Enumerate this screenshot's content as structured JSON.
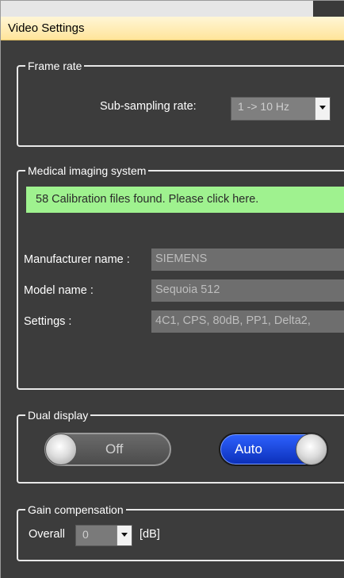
{
  "window": {
    "title": "Video Settings"
  },
  "frame_rate": {
    "legend": "Frame rate",
    "sub_sampling_label": "Sub-sampling rate:",
    "sub_sampling_value": "1 -> 10 Hz"
  },
  "medical": {
    "legend": "Medical imaging system",
    "calibration_message": "58 Calibration files found. Please click here.",
    "fields": [
      {
        "label": "Manufacturer name :",
        "value": "SIEMENS"
      },
      {
        "label": "Model name :",
        "value": "Sequoia 512"
      },
      {
        "label": "Settings :",
        "value": "4C1, CPS, 80dB, PP1, Delta2,"
      }
    ]
  },
  "dual_display": {
    "legend": "Dual display",
    "off_label": "Off",
    "auto_label": "Auto"
  },
  "gain": {
    "legend": "Gain compensation",
    "overall_label": "Overall",
    "overall_value": "0",
    "unit": "[dB]"
  },
  "colors": {
    "panel_bg": "#3c3c3c",
    "title_bg": "#ffe49a",
    "calibration_bg": "#9ff28f",
    "auto_blue": "#1f4fe6"
  }
}
